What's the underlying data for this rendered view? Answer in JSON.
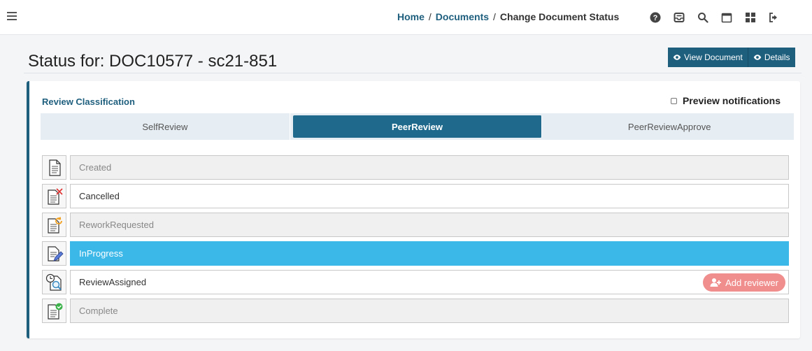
{
  "breadcrumb": {
    "home": "Home",
    "sep1": "/",
    "documents": "Documents",
    "sep2": "/",
    "current": "Change Document Status"
  },
  "topbar": {
    "icons": [
      "help-icon",
      "inbox-icon",
      "search-icon",
      "calendar-icon",
      "apps-grid-icon",
      "logout-icon"
    ]
  },
  "page": {
    "title": "Status for: DOC10577 - sc21-851",
    "view_document_label": "View Document",
    "details_label": "Details"
  },
  "card": {
    "title": "Review Classification",
    "preview_label": "Preview notifications",
    "preview_checked": false
  },
  "tabs": [
    {
      "label": "SelfReview",
      "active": false
    },
    {
      "label": "PeerReview",
      "active": true
    },
    {
      "label": "PeerReviewApprove",
      "active": false
    }
  ],
  "statuses": [
    {
      "label": "Created",
      "state": "disabled",
      "icon": "document-icon"
    },
    {
      "label": "Cancelled",
      "state": "available",
      "icon": "document-cancel-icon"
    },
    {
      "label": "ReworkRequested",
      "state": "disabled",
      "icon": "document-rework-icon"
    },
    {
      "label": "InProgress",
      "state": "current",
      "icon": "document-edit-icon"
    },
    {
      "label": "ReviewAssigned",
      "state": "available",
      "icon": "review-assigned-icon"
    },
    {
      "label": "Complete",
      "state": "disabled",
      "icon": "document-complete-icon"
    }
  ],
  "add_reviewer_label": "Add reviewer",
  "colors": {
    "primary": "#1f5f7e",
    "active_status": "#3bb8e8",
    "add_reviewer": "#f08e8e"
  }
}
